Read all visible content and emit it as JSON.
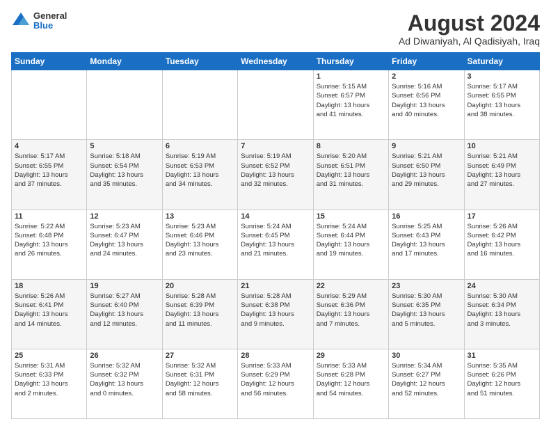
{
  "logo": {
    "general": "General",
    "blue": "Blue"
  },
  "header": {
    "title": "August 2024",
    "subtitle": "Ad Diwaniyah, Al Qadisiyah, Iraq"
  },
  "weekdays": [
    "Sunday",
    "Monday",
    "Tuesday",
    "Wednesday",
    "Thursday",
    "Friday",
    "Saturday"
  ],
  "weeks": [
    [
      {
        "day": "",
        "info": ""
      },
      {
        "day": "",
        "info": ""
      },
      {
        "day": "",
        "info": ""
      },
      {
        "day": "",
        "info": ""
      },
      {
        "day": "1",
        "info": "Sunrise: 5:15 AM\nSunset: 6:57 PM\nDaylight: 13 hours\nand 41 minutes."
      },
      {
        "day": "2",
        "info": "Sunrise: 5:16 AM\nSunset: 6:56 PM\nDaylight: 13 hours\nand 40 minutes."
      },
      {
        "day": "3",
        "info": "Sunrise: 5:17 AM\nSunset: 6:55 PM\nDaylight: 13 hours\nand 38 minutes."
      }
    ],
    [
      {
        "day": "4",
        "info": "Sunrise: 5:17 AM\nSunset: 6:55 PM\nDaylight: 13 hours\nand 37 minutes."
      },
      {
        "day": "5",
        "info": "Sunrise: 5:18 AM\nSunset: 6:54 PM\nDaylight: 13 hours\nand 35 minutes."
      },
      {
        "day": "6",
        "info": "Sunrise: 5:19 AM\nSunset: 6:53 PM\nDaylight: 13 hours\nand 34 minutes."
      },
      {
        "day": "7",
        "info": "Sunrise: 5:19 AM\nSunset: 6:52 PM\nDaylight: 13 hours\nand 32 minutes."
      },
      {
        "day": "8",
        "info": "Sunrise: 5:20 AM\nSunset: 6:51 PM\nDaylight: 13 hours\nand 31 minutes."
      },
      {
        "day": "9",
        "info": "Sunrise: 5:21 AM\nSunset: 6:50 PM\nDaylight: 13 hours\nand 29 minutes."
      },
      {
        "day": "10",
        "info": "Sunrise: 5:21 AM\nSunset: 6:49 PM\nDaylight: 13 hours\nand 27 minutes."
      }
    ],
    [
      {
        "day": "11",
        "info": "Sunrise: 5:22 AM\nSunset: 6:48 PM\nDaylight: 13 hours\nand 26 minutes."
      },
      {
        "day": "12",
        "info": "Sunrise: 5:23 AM\nSunset: 6:47 PM\nDaylight: 13 hours\nand 24 minutes."
      },
      {
        "day": "13",
        "info": "Sunrise: 5:23 AM\nSunset: 6:46 PM\nDaylight: 13 hours\nand 23 minutes."
      },
      {
        "day": "14",
        "info": "Sunrise: 5:24 AM\nSunset: 6:45 PM\nDaylight: 13 hours\nand 21 minutes."
      },
      {
        "day": "15",
        "info": "Sunrise: 5:24 AM\nSunset: 6:44 PM\nDaylight: 13 hours\nand 19 minutes."
      },
      {
        "day": "16",
        "info": "Sunrise: 5:25 AM\nSunset: 6:43 PM\nDaylight: 13 hours\nand 17 minutes."
      },
      {
        "day": "17",
        "info": "Sunrise: 5:26 AM\nSunset: 6:42 PM\nDaylight: 13 hours\nand 16 minutes."
      }
    ],
    [
      {
        "day": "18",
        "info": "Sunrise: 5:26 AM\nSunset: 6:41 PM\nDaylight: 13 hours\nand 14 minutes."
      },
      {
        "day": "19",
        "info": "Sunrise: 5:27 AM\nSunset: 6:40 PM\nDaylight: 13 hours\nand 12 minutes."
      },
      {
        "day": "20",
        "info": "Sunrise: 5:28 AM\nSunset: 6:39 PM\nDaylight: 13 hours\nand 11 minutes."
      },
      {
        "day": "21",
        "info": "Sunrise: 5:28 AM\nSunset: 6:38 PM\nDaylight: 13 hours\nand 9 minutes."
      },
      {
        "day": "22",
        "info": "Sunrise: 5:29 AM\nSunset: 6:36 PM\nDaylight: 13 hours\nand 7 minutes."
      },
      {
        "day": "23",
        "info": "Sunrise: 5:30 AM\nSunset: 6:35 PM\nDaylight: 13 hours\nand 5 minutes."
      },
      {
        "day": "24",
        "info": "Sunrise: 5:30 AM\nSunset: 6:34 PM\nDaylight: 13 hours\nand 3 minutes."
      }
    ],
    [
      {
        "day": "25",
        "info": "Sunrise: 5:31 AM\nSunset: 6:33 PM\nDaylight: 13 hours\nand 2 minutes."
      },
      {
        "day": "26",
        "info": "Sunrise: 5:32 AM\nSunset: 6:32 PM\nDaylight: 13 hours\nand 0 minutes."
      },
      {
        "day": "27",
        "info": "Sunrise: 5:32 AM\nSunset: 6:31 PM\nDaylight: 12 hours\nand 58 minutes."
      },
      {
        "day": "28",
        "info": "Sunrise: 5:33 AM\nSunset: 6:29 PM\nDaylight: 12 hours\nand 56 minutes."
      },
      {
        "day": "29",
        "info": "Sunrise: 5:33 AM\nSunset: 6:28 PM\nDaylight: 12 hours\nand 54 minutes."
      },
      {
        "day": "30",
        "info": "Sunrise: 5:34 AM\nSunset: 6:27 PM\nDaylight: 12 hours\nand 52 minutes."
      },
      {
        "day": "31",
        "info": "Sunrise: 5:35 AM\nSunset: 6:26 PM\nDaylight: 12 hours\nand 51 minutes."
      }
    ]
  ]
}
